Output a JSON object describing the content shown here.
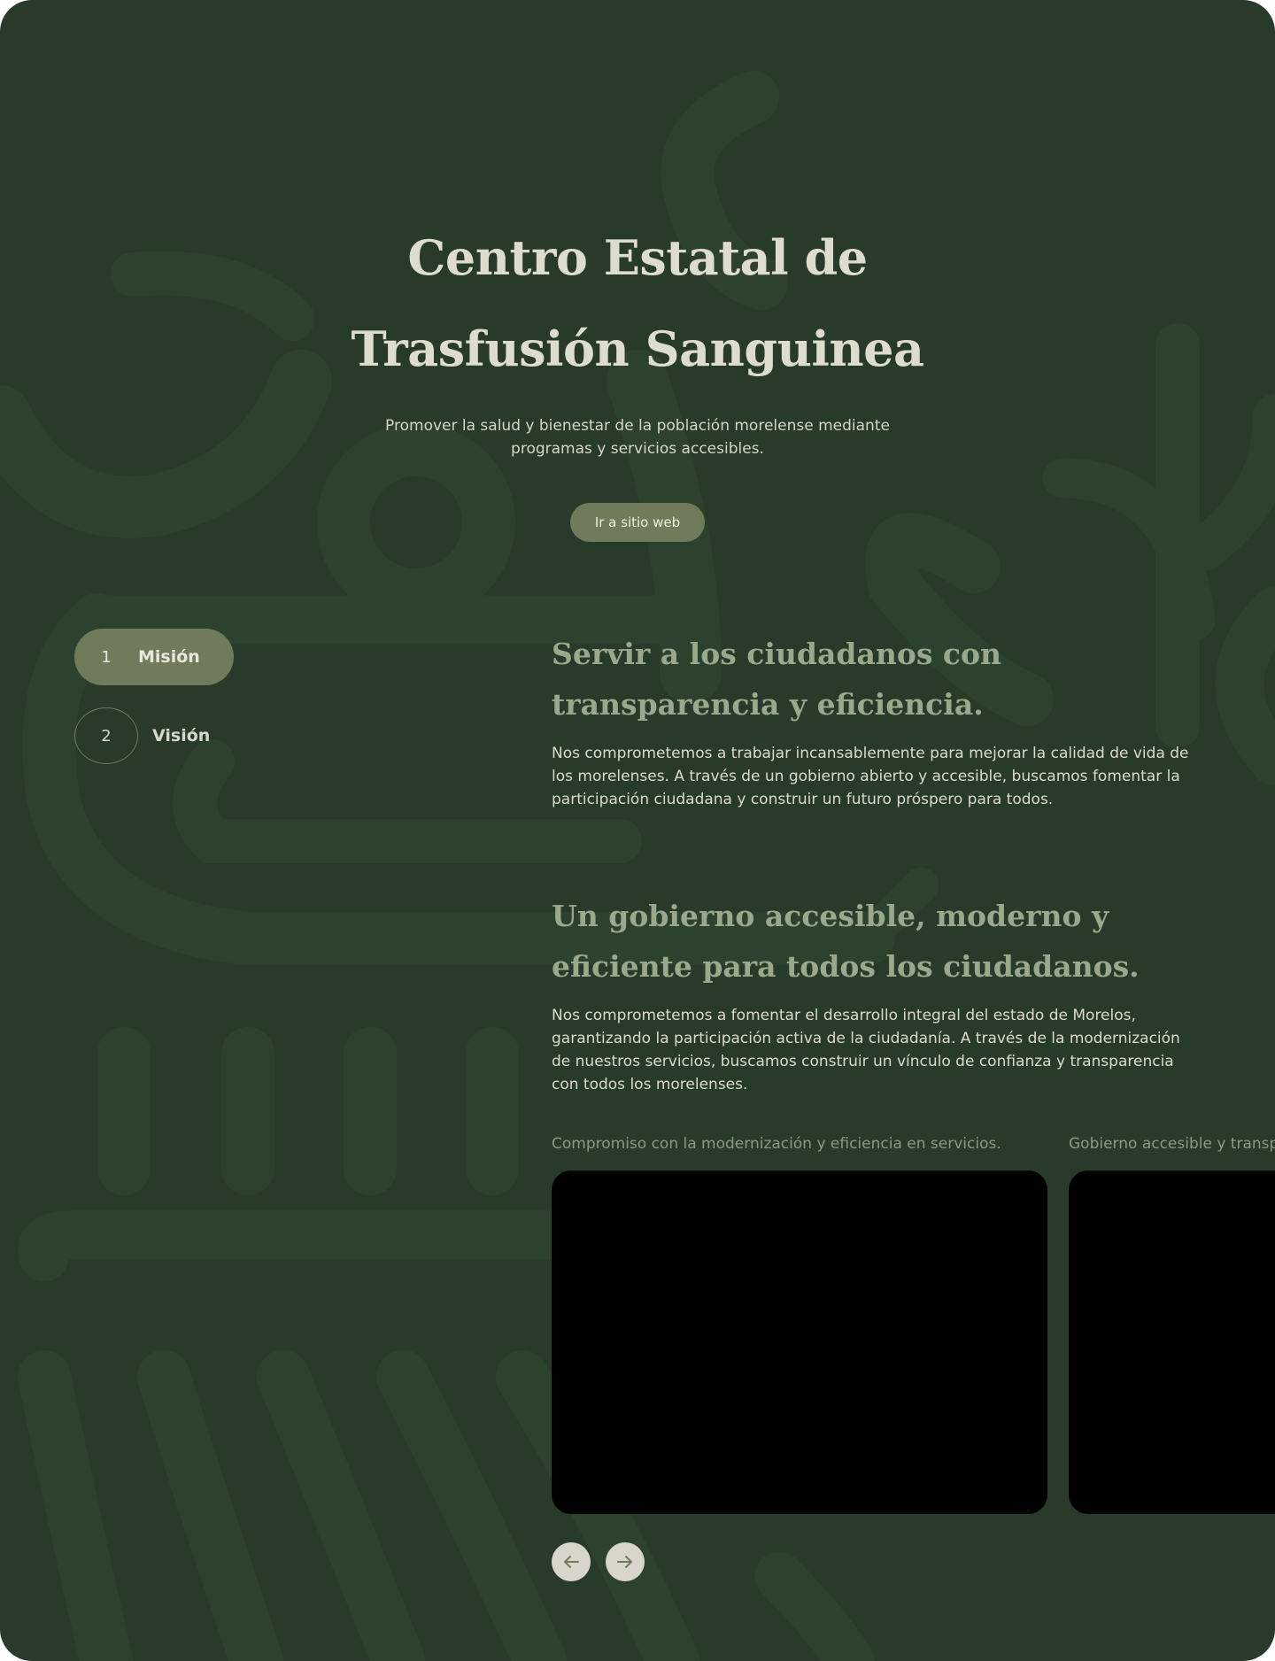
{
  "hero": {
    "title_line1": "Centro Estatal de",
    "title_line2": "Trasfusión Sanguinea",
    "subtitle": "Promover la salud y bienestar de la población morelense mediante programas y servicios accesibles.",
    "cta_label": "Ir a sitio web"
  },
  "tabs": [
    {
      "number": "1",
      "label": "Misión",
      "active": true
    },
    {
      "number": "2",
      "label": "Visión",
      "active": false
    }
  ],
  "sections": [
    {
      "heading": "Servir a los ciudadanos con transparencia y eficiencia.",
      "body": "Nos comprometemos a trabajar incansablemente para mejorar la calidad de vida de los morelenses. A través de un gobierno abierto y accesible, buscamos fomentar la participación ciudadana y construir un futuro próspero para todos."
    },
    {
      "heading": "Un gobierno accesible, moderno y eficiente para todos los ciudadanos.",
      "body": "Nos comprometemos a fomentar el desarrollo integral del estado de Morelos, garantizando la participación activa de la ciudadanía. A través de la modernización de nuestros servicios, buscamos construir un vínculo de confianza y transparencia con todos los morelenses."
    }
  ],
  "carousel": {
    "slides": [
      {
        "caption": "Compromiso con la modernización y eficiencia en servicios."
      },
      {
        "caption": "Gobierno accesible y transparente"
      }
    ],
    "prev_icon": "arrow-left-icon",
    "next_icon": "arrow-right-icon"
  },
  "colors": {
    "background": "#283a29",
    "accent": "#6f7b5b",
    "heading_muted": "#9aa88b",
    "text_light": "#dcdacd"
  }
}
